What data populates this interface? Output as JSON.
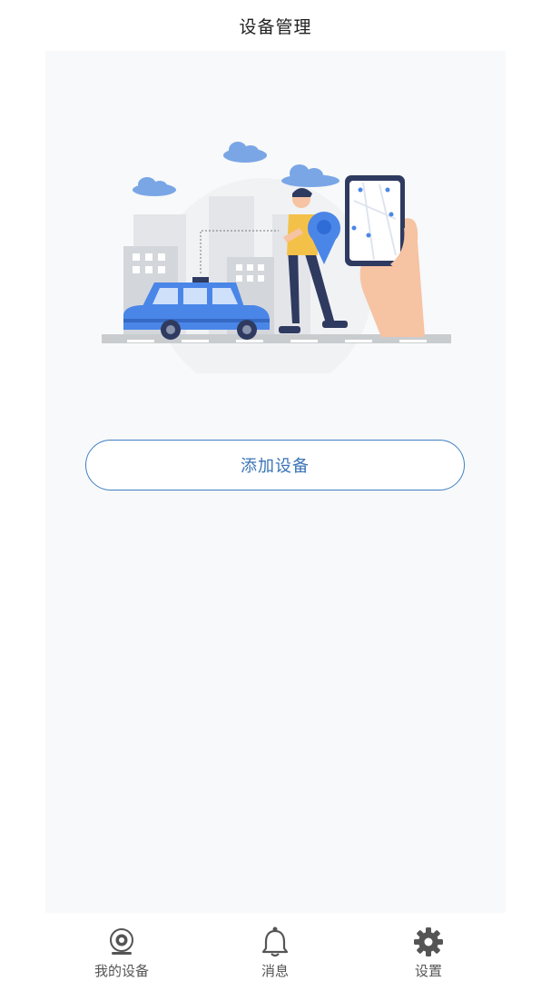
{
  "header": {
    "title": "设备管理"
  },
  "main": {
    "add_button_label": "添加设备",
    "illustration_icon": "car-location-illustration"
  },
  "tabbar": {
    "items": [
      {
        "label": "我的设备",
        "icon": "camera-icon"
      },
      {
        "label": "消息",
        "icon": "bell-icon"
      },
      {
        "label": "设置",
        "icon": "gear-icon"
      }
    ]
  },
  "colors": {
    "accent": "#3f7fc3",
    "content_bg": "#f7f9fa",
    "car_blue": "#4a86e8",
    "icon_gray": "#555555"
  }
}
